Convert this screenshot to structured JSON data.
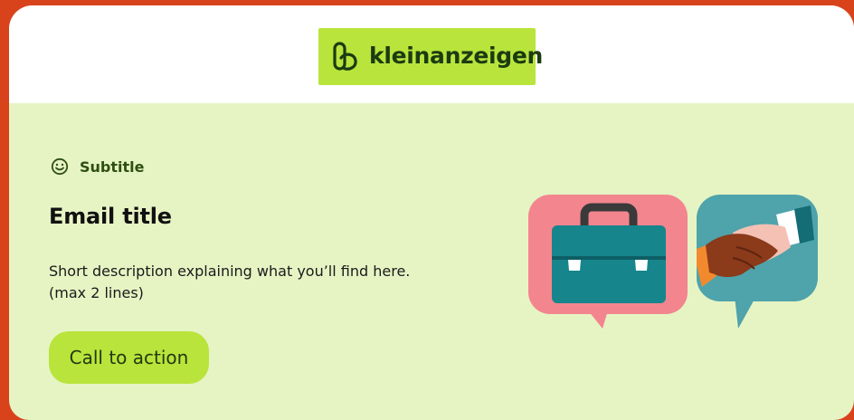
{
  "logo": {
    "text": "kleinanzeigen"
  },
  "content": {
    "subtitle": "Subtitle",
    "title": "Email title",
    "description_line1": "Short description explaining what you’ll find here.",
    "description_line2": "(max 2 lines)",
    "cta_label": "Call to action"
  },
  "colors": {
    "frame": "#d8431c",
    "header_bg": "#ffffff",
    "body_bg": "#e6f4c4",
    "brand_green": "#b9e43c",
    "brand_dark": "#1b3b12"
  },
  "icons": {
    "subtitle_icon": "smile-icon",
    "illustration_left": "briefcase-speech-bubble",
    "illustration_right": "handshake-speech-bubble"
  }
}
